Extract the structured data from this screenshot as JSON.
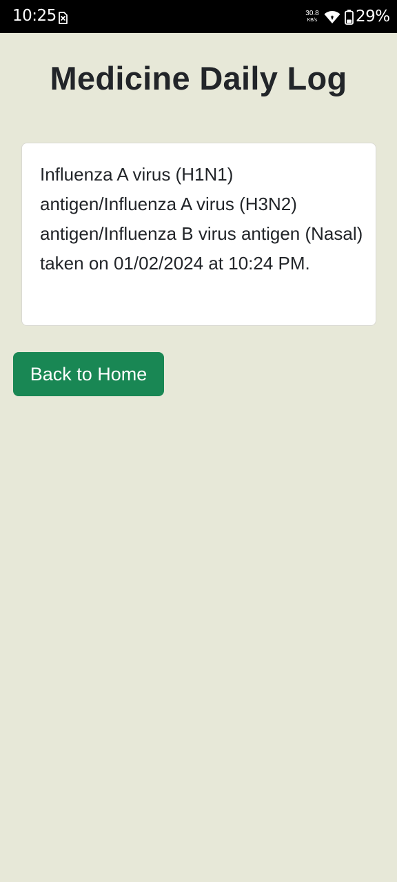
{
  "status_bar": {
    "time": "10:25",
    "notification_icon": "sim-error-icon",
    "network_speed_value": "30.8",
    "network_speed_unit": "KB/s",
    "wifi_icon": "wifi-icon",
    "battery_icon": "battery-icon",
    "battery_percent": "29%"
  },
  "page": {
    "title": "Medicine Daily Log"
  },
  "log_entries": [
    {
      "text": "Influenza A virus (H1N1) antigen/Influenza A virus (H3N2) antigen/Influenza B virus antigen (Nasal) taken on 01/02/2024 at 10:24 PM."
    }
  ],
  "actions": {
    "back_label": "Back to Home"
  },
  "colors": {
    "background": "#e7e8d8",
    "primary_button": "#198754",
    "card": "#ffffff",
    "text": "#222529"
  }
}
